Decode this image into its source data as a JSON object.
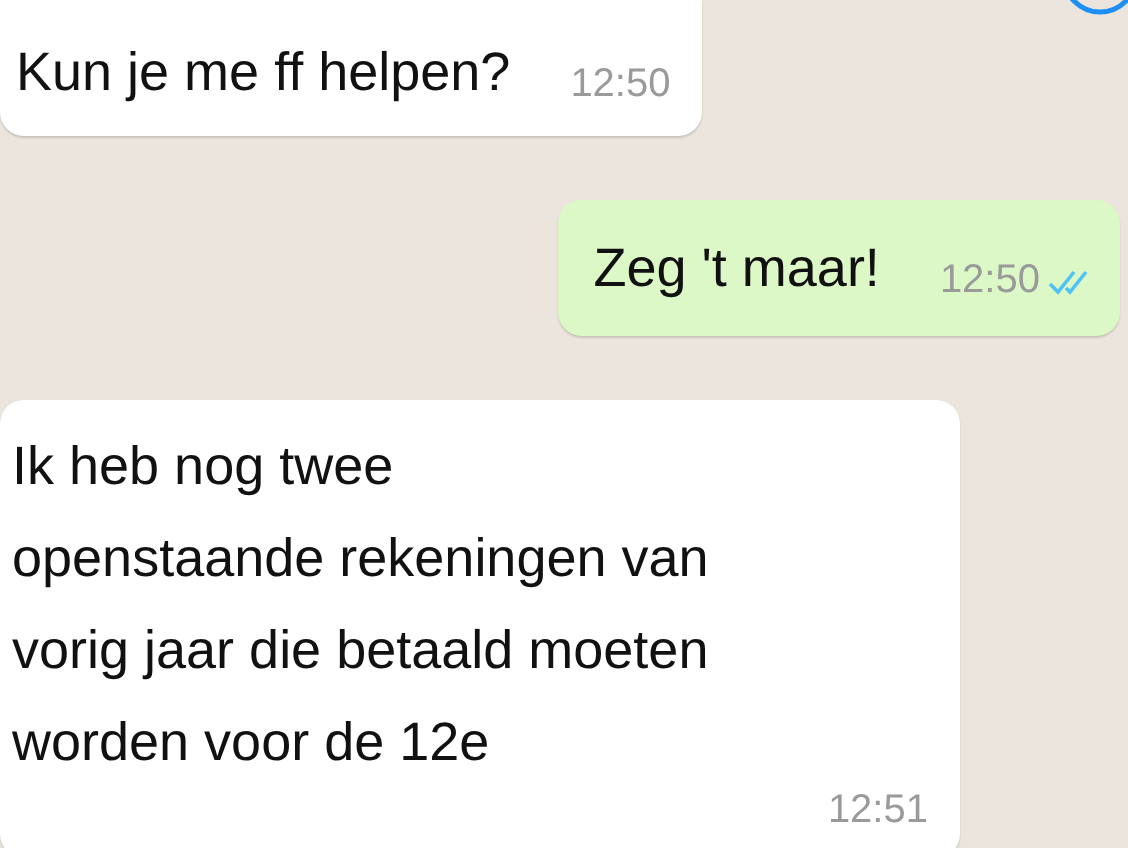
{
  "messages": [
    {
      "kind": "in",
      "text": "Kun je me ff helpen?",
      "time": "12:50"
    },
    {
      "kind": "out",
      "text": "Zeg 't maar!",
      "time": "12:50",
      "read": true
    },
    {
      "kind": "in",
      "text": "Ik heb nog twee openstaande rekeningen van vorig jaar die betaald moeten worden voor de 12e",
      "time": "12:51"
    }
  ]
}
